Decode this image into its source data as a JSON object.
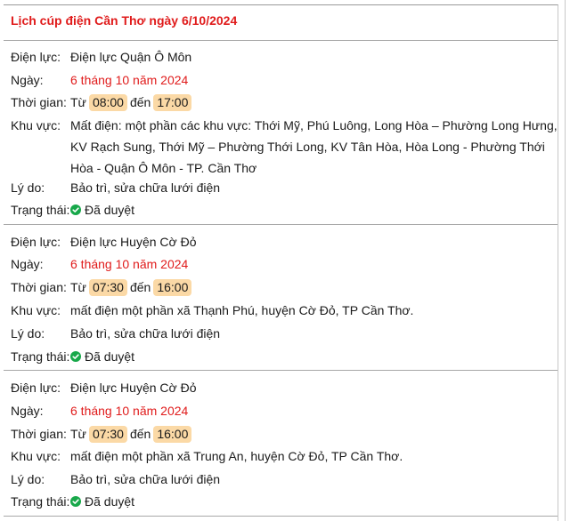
{
  "title": "Lịch cúp điện Cần Thơ ngày 6/10/2024",
  "labels": {
    "utility": "Điện lực:",
    "date": "Ngày:",
    "time": "Thời gian:",
    "area": "Khu vực:",
    "reason": "Lý do:",
    "status": "Trạng thái:",
    "from": "Từ",
    "to": "đến"
  },
  "colors": {
    "accent_red": "#e01b1b",
    "time_pill": "#fbd9a6",
    "approved_green": "#18a84a"
  },
  "entries": [
    {
      "utility": "Điện lực Quận Ô Môn",
      "date": "6 tháng 10 năm 2024",
      "start": "08:00",
      "end": "17:00",
      "area": "Mất điện: một phần các khu vực: Thới Mỹ, Phú Luông, Long Hòa – Phường Long Hưng, KV Rạch Sung, Thới Mỹ – Phường Thới Long, KV Tân Hòa, Hòa Long - Phường Thới Hòa - Quận Ô Môn - TP. Cần Thơ",
      "reason": "Bảo trì, sửa chữa lưới điện",
      "status": "Đã duyệt",
      "status_icon": "check-circle-icon"
    },
    {
      "utility": "Điện lực Huyện Cờ Đỏ",
      "date": "6 tháng 10 năm 2024",
      "start": "07:30",
      "end": "16:00",
      "area": "mất điện một phần xã Thạnh Phú, huyện Cờ Đỏ, TP Cần Thơ.",
      "reason": "Bảo trì, sửa chữa lưới điện",
      "status": "Đã duyệt",
      "status_icon": "check-circle-icon"
    },
    {
      "utility": "Điện lực Huyện Cờ Đỏ",
      "date": "6 tháng 10 năm 2024",
      "start": "07:30",
      "end": "16:00",
      "area": "mất điện một phần xã Trung An, huyện Cờ Đỏ, TP Cần Thơ.",
      "reason": "Bảo trì, sửa chữa lưới điện",
      "status": "Đã duyệt",
      "status_icon": "check-circle-icon"
    }
  ]
}
